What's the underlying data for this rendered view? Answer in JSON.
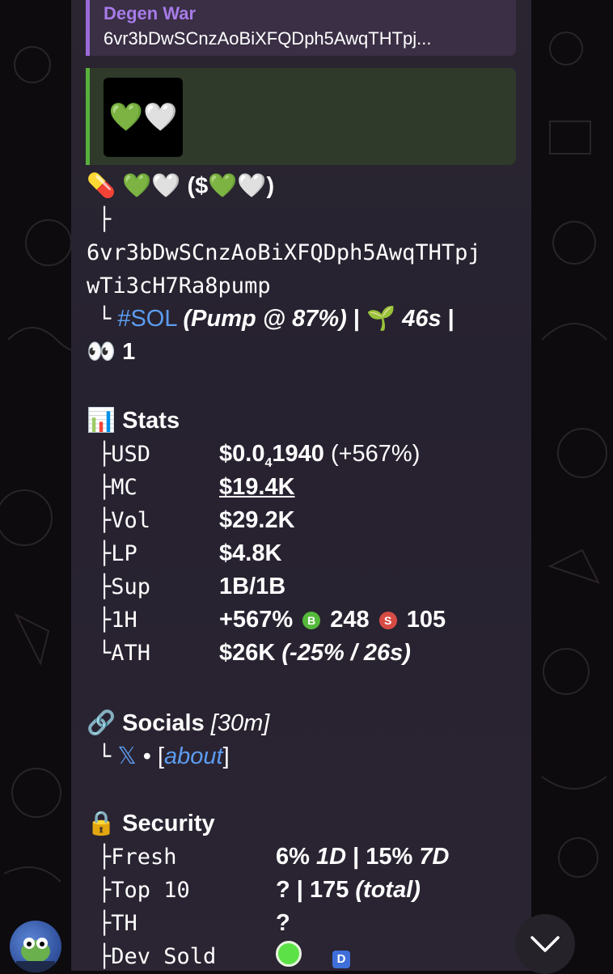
{
  "reply": {
    "title": "Degen War",
    "text": "6vr3bDwSCnzAoBiXFQDph5AwqTHTpj..."
  },
  "preview": {
    "thumb_emoji": "💚🤍"
  },
  "header": {
    "icon": "pill-icon",
    "name": "💚🤍",
    "ticker": "($💚🤍)",
    "branch": "├",
    "address_1": "6vr3bDwSCnzAoBiXFQDph5AwqTHTpj",
    "address_2": "wTi3cH7Ra8pump",
    "chain_prefix": "└",
    "chain": "#SOL",
    "pump_status": "(Pump @ 87%)",
    "sep": "|",
    "age": "46s",
    "sep2": "|",
    "watchers": "1"
  },
  "stats": {
    "heading": "Stats",
    "rows": [
      {
        "key": "├USD",
        "value": "$0.0₄1940 (+567%)"
      },
      {
        "key": "├MC",
        "value": "$19.4K"
      },
      {
        "key": "├Vol",
        "value": "$29.2K"
      },
      {
        "key": "├LP",
        "value": "$4.8K"
      },
      {
        "key": "├Sup",
        "value": "1B/1B"
      },
      {
        "key": "├1H",
        "value": "+567%",
        "buys": "248",
        "sells": "105"
      },
      {
        "key": "└ATH",
        "value": "$26K",
        "value_extra": "(-25% / 26s)"
      }
    ]
  },
  "socials": {
    "heading": "Socials",
    "age": "[30m]",
    "prefix": "└",
    "x_label": "𝕏",
    "bullet": "•",
    "about_open": "[",
    "about": "about",
    "about_close": "]"
  },
  "security": {
    "heading": "Security",
    "rows": [
      {
        "key": "├Fresh",
        "value": "6% 1D | 15% 7D"
      },
      {
        "key": "├Top 10",
        "value": "? | 175",
        "value_extra": "(total)"
      },
      {
        "key": "├TH",
        "value": "?"
      },
      {
        "key": "├Dev Sold",
        "value": ""
      }
    ],
    "dev_badge": "D"
  },
  "badges": {
    "buy": "B",
    "sell": "S"
  },
  "colors": {
    "accent_purple": "#9a6bd8",
    "accent_green": "#58b03c",
    "link": "#5c9cf0"
  }
}
